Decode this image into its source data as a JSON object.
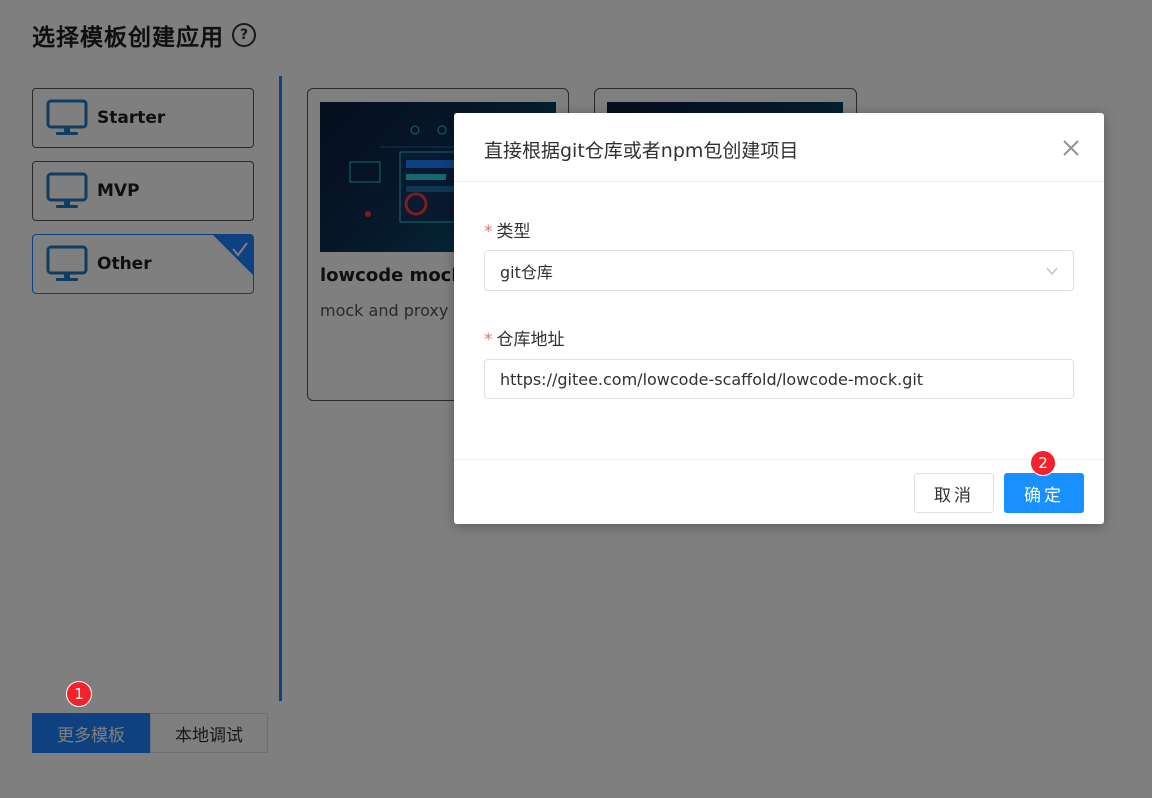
{
  "page": {
    "title": "选择模板创建应用",
    "help_icon": "question-circle-icon"
  },
  "categories": [
    {
      "label": "Starter",
      "icon": "monitor-icon",
      "selected": false
    },
    {
      "label": "MVP",
      "icon": "monitor-icon",
      "selected": false
    },
    {
      "label": "Other",
      "icon": "monitor-icon",
      "selected": true
    }
  ],
  "templates": [
    {
      "title": "lowcode mock",
      "description": "mock and proxy t"
    },
    {
      "title": "",
      "description": ""
    }
  ],
  "bottom_tabs": {
    "more": "更多模板",
    "local": "本地调试"
  },
  "badges": {
    "first": "1",
    "second": "2"
  },
  "modal": {
    "title": "直接根据git仓库或者npm包创建项目",
    "type_label": "类型",
    "type_value": "git仓库",
    "repo_label": "仓库地址",
    "repo_value": "https://gitee.com/lowcode-scaffold/lowcode-mock.git",
    "required_mark": "*",
    "cancel_label": "取消",
    "ok_label": "确定"
  },
  "colors": {
    "accent": "#1e80ff",
    "primary_button": "#1890ff",
    "badge": "#f5222d",
    "required": "#f56c6c"
  }
}
